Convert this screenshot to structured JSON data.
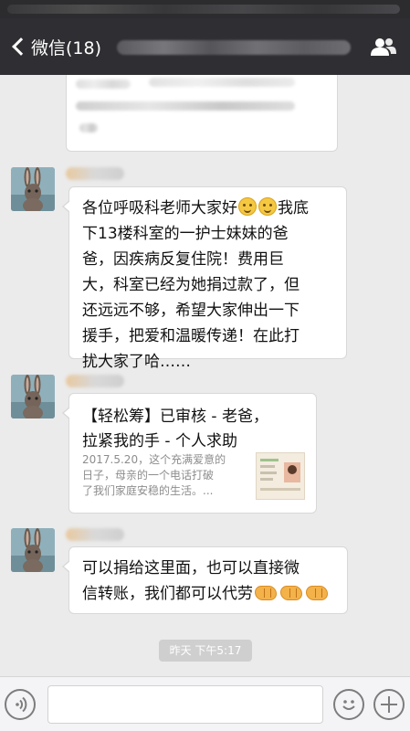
{
  "nav": {
    "back_label": "微信(18)",
    "back_icon": "chevron-left-icon",
    "contact_icon": "contact-group-icon"
  },
  "messages": {
    "msg2": {
      "lines": [
        "各位呼吸科老师大家好",
        "我底",
        "下13楼科室的一护士妹妹的爸",
        "爸，因疾病反复住院！费用巨",
        "大，科室已经为她捐过款了，但",
        "还远远不够，希望大家伸出一下",
        "援手，把爱和温暖传递！在此打",
        "扰大家了哈……"
      ],
      "emoji": [
        "smile-emoji",
        "smile-emoji"
      ]
    },
    "card": {
      "title_line1": "【轻松筹】已审核 - 老爸，",
      "title_line2": "拉紧我的手 - 个人求助",
      "desc_line1": "2017.5.20，这个充满爱意的",
      "desc_line2": "日子，母亲的一个电话打破",
      "desc_line3": "了我们家庭安稳的生活。..."
    },
    "msg4": {
      "line1": "可以捐给这里面，也可以直接微",
      "line2": "信转账，我们都可以代劳",
      "emoji": [
        "handshake-emoji",
        "handshake-emoji",
        "handshake-emoji"
      ]
    }
  },
  "timestamp": "昨天 下午5:17",
  "input_bar": {
    "voice_icon": "voice-icon",
    "emoji_icon": "emoji-face-icon",
    "plus_icon": "plus-icon"
  },
  "colors": {
    "nav_bg": "#2f2f33",
    "chat_bg": "#ebebeb",
    "bubble_bg": "#ffffff",
    "meta_text": "#8d8d8d"
  }
}
